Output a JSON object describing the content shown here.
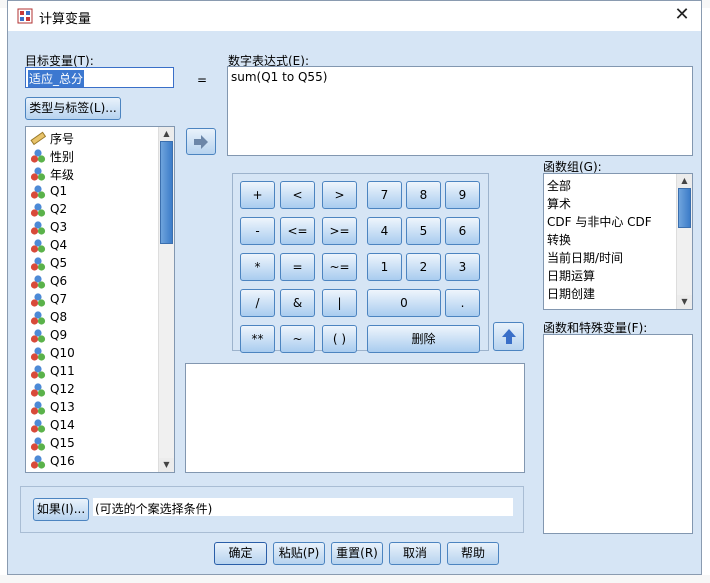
{
  "window": {
    "title": "计算变量",
    "close_label": "✕"
  },
  "target_var": {
    "label": "目标变量(T):",
    "value": "适应_总分"
  },
  "equals_sign": "=",
  "type_label_button": "类型与标签(L)...",
  "numeric_expression": {
    "label": "数字表达式(E):",
    "value": "sum(Q1 to Q55)"
  },
  "variables": [
    {
      "name": "序号",
      "icon": "ruler-icon"
    },
    {
      "name": "性别",
      "icon": "nominal-icon"
    },
    {
      "name": "年级",
      "icon": "nominal-icon"
    },
    {
      "name": "Q1",
      "icon": "nominal-icon"
    },
    {
      "name": "Q2",
      "icon": "nominal-icon"
    },
    {
      "name": "Q3",
      "icon": "nominal-icon"
    },
    {
      "name": "Q4",
      "icon": "nominal-icon"
    },
    {
      "name": "Q5",
      "icon": "nominal-icon"
    },
    {
      "name": "Q6",
      "icon": "nominal-icon"
    },
    {
      "name": "Q7",
      "icon": "nominal-icon"
    },
    {
      "name": "Q8",
      "icon": "nominal-icon"
    },
    {
      "name": "Q9",
      "icon": "nominal-icon"
    },
    {
      "name": "Q10",
      "icon": "nominal-icon"
    },
    {
      "name": "Q11",
      "icon": "nominal-icon"
    },
    {
      "name": "Q12",
      "icon": "nominal-icon"
    },
    {
      "name": "Q13",
      "icon": "nominal-icon"
    },
    {
      "name": "Q14",
      "icon": "nominal-icon"
    },
    {
      "name": "Q15",
      "icon": "nominal-icon"
    },
    {
      "name": "Q16",
      "icon": "nominal-icon"
    }
  ],
  "keypad": {
    "row1": [
      "+",
      "<",
      ">",
      "7",
      "8",
      "9"
    ],
    "row2": [
      "-",
      "<=",
      ">=",
      "4",
      "5",
      "6"
    ],
    "row3": [
      "*",
      "=",
      "~=",
      "1",
      "2",
      "3"
    ],
    "row4": [
      "/",
      "&",
      "|",
      "0",
      "."
    ],
    "row5": [
      "**",
      "~",
      "( )",
      "删除"
    ]
  },
  "function_group": {
    "label": "函数组(G):",
    "items": [
      "全部",
      "算术",
      "CDF 与非中心 CDF",
      "转换",
      "当前日期/时间",
      "日期运算",
      "日期创建"
    ]
  },
  "functions_label": "函数和特殊变量(F):",
  "if_button": "如果(I)...",
  "if_condition_text": "(可选的个案选择条件)",
  "buttons": {
    "ok": "确定",
    "paste": "粘贴(P)",
    "reset": "重置(R)",
    "cancel": "取消",
    "help": "帮助"
  },
  "colors": {
    "dialog_bg": "#d6e5f5",
    "button_border": "#4c84c0",
    "scroll_thumb": "#3c7cc8"
  }
}
